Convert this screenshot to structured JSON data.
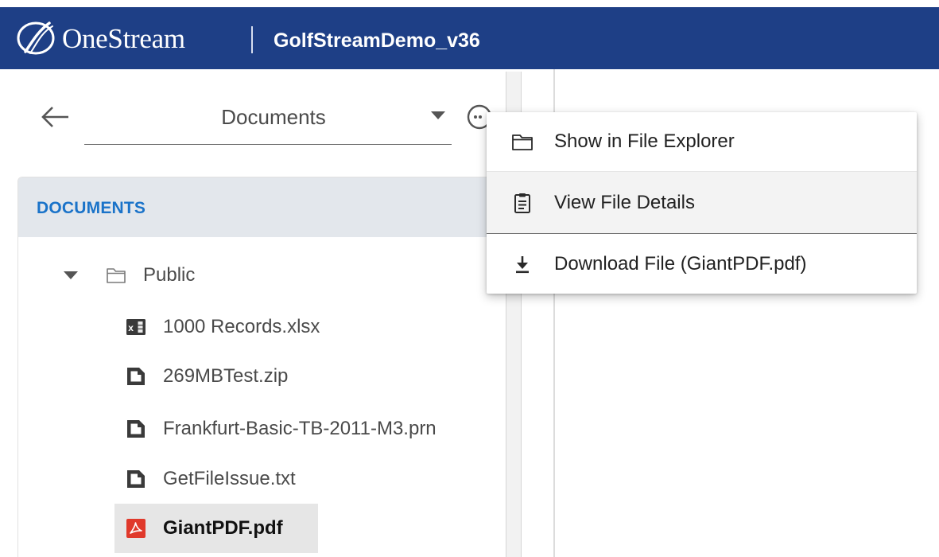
{
  "header": {
    "brand": "OneStream",
    "app_name": "GolfStreamDemo_v36",
    "background": "#1e3f86"
  },
  "navigator": {
    "back_icon": "arrow-left-icon",
    "selected_view": "Documents",
    "more_icon": "more-horizontal-circle-icon"
  },
  "tree": {
    "title": "DOCUMENTS",
    "folder": {
      "name": "Public",
      "expanded": true,
      "icon": "folder-outline-icon"
    },
    "files": [
      {
        "name": "1000 Records.xlsx",
        "icon": "excel-file-icon",
        "selected": false
      },
      {
        "name": "269MBTest.zip",
        "icon": "file-icon",
        "selected": false
      },
      {
        "name": "Frankfurt-Basic-TB-2011-M3.prn",
        "icon": "file-icon",
        "selected": false
      },
      {
        "name": "GetFileIssue.txt",
        "icon": "file-icon",
        "selected": false
      },
      {
        "name": "GiantPDF.pdf",
        "icon": "pdf-file-icon",
        "selected": true
      }
    ]
  },
  "context_menu": {
    "items": [
      {
        "label": "Show in File Explorer",
        "icon": "folder-outline-icon"
      },
      {
        "label": "View File Details",
        "icon": "clipboard-list-icon"
      },
      {
        "label": "Download File (GiantPDF.pdf)",
        "icon": "download-icon"
      }
    ]
  },
  "colors": {
    "accent": "#1a73c9",
    "pdf_red": "#e0392b"
  }
}
